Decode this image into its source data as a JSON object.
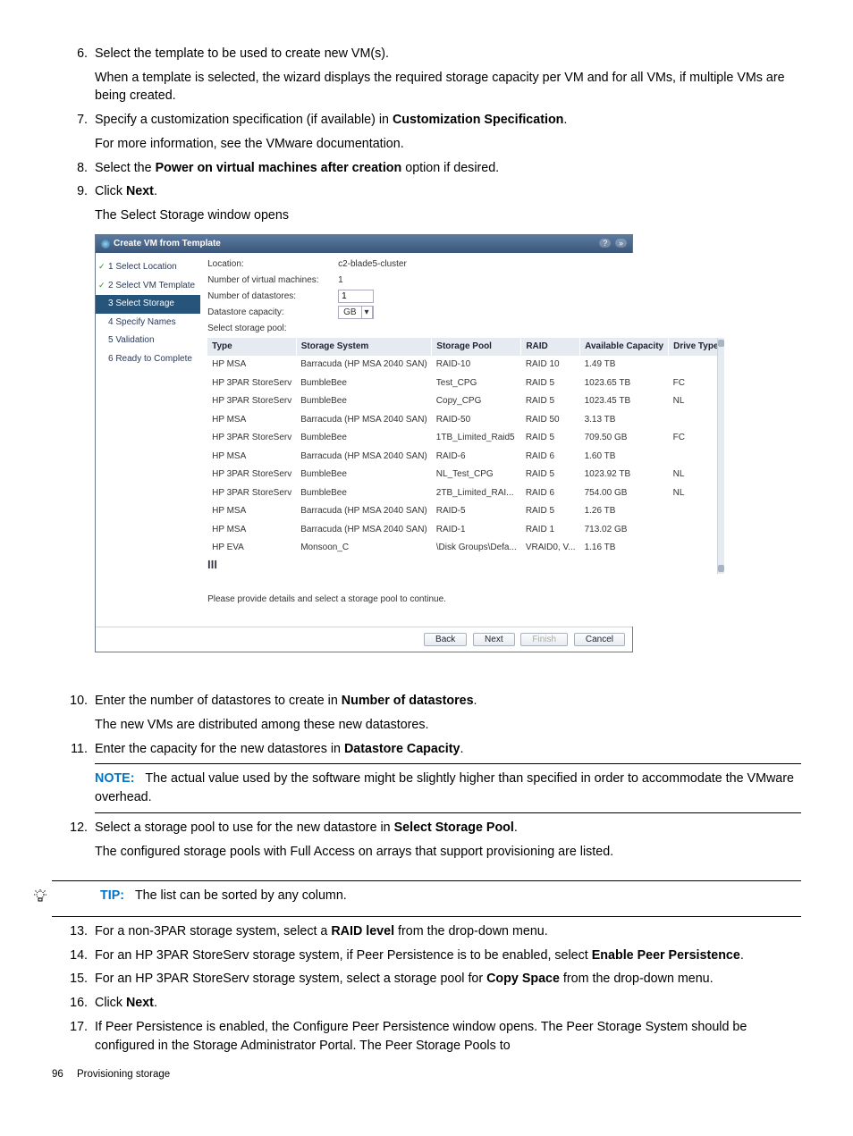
{
  "steps": {
    "s6": {
      "num": "6.",
      "p1": "Select the template to be used to create new VM(s).",
      "p2": "When a template is selected, the wizard displays the required storage capacity per VM and for all VMs, if multiple VMs are being created."
    },
    "s7": {
      "num": "7.",
      "p1a": "Specify a customization specification (if available) in ",
      "p1b": "Customization Specification",
      "p1c": ".",
      "p2": "For more information, see the VMware documentation."
    },
    "s8": {
      "num": "8.",
      "p1a": "Select the ",
      "p1b": "Power on virtual machines after creation",
      "p1c": " option if desired."
    },
    "s9": {
      "num": "9.",
      "p1a": "Click ",
      "p1b": "Next",
      "p1c": ".",
      "p2": "The Select Storage window opens"
    },
    "s10": {
      "num": "10.",
      "p1a": "Enter the number of datastores to create in ",
      "p1b": "Number of datastores",
      "p1c": ".",
      "p2": "The new VMs are distributed among these new datastores."
    },
    "s11": {
      "num": "11.",
      "p1a": "Enter the capacity for the new datastores in ",
      "p1b": "Datastore Capacity",
      "p1c": "."
    },
    "note": {
      "label": "NOTE:",
      "text": "The actual value used by the software might be slightly higher than specified in order to accommodate the VMware overhead."
    },
    "s12": {
      "num": "12.",
      "p1a": "Select a storage pool to use for the new datastore in ",
      "p1b": "Select Storage Pool",
      "p1c": ".",
      "p2": "The configured storage pools with Full Access on arrays that support provisioning are listed."
    },
    "tip": {
      "label": "TIP:",
      "text": "The list can be sorted by any column."
    },
    "s13": {
      "num": "13.",
      "p1a": "For a non-3PAR storage system, select a ",
      "p1b": "RAID level",
      "p1c": " from the drop-down menu."
    },
    "s14": {
      "num": "14.",
      "p1a": "For an HP 3PAR StoreServ storage system, if Peer Persistence is to be enabled, select ",
      "p1b": "Enable Peer Persistence",
      "p1c": "."
    },
    "s15": {
      "num": "15.",
      "p1a": "For an HP 3PAR StoreServ storage system, select a storage pool for ",
      "p1b": "Copy Space",
      "p1c": " from the drop-down menu."
    },
    "s16": {
      "num": "16.",
      "p1a": "Click ",
      "p1b": "Next",
      "p1c": "."
    },
    "s17": {
      "num": "17.",
      "p1": "If Peer Persistence is enabled, the Configure Peer Persistence window opens. The Peer Storage System should be configured in the Storage Administrator Portal. The Peer Storage Pools to"
    }
  },
  "dialog": {
    "title": "Create VM from Template",
    "nav": {
      "step1": "1 Select Location",
      "step2": "2 Select VM Template",
      "step3": "3 Select Storage",
      "step4": "4 Specify Names",
      "step5": "5 Validation",
      "step6": "6 Ready to Complete"
    },
    "form": {
      "location_lbl": "Location:",
      "location_val": "c2-blade5-cluster",
      "numvm_lbl": "Number of virtual machines:",
      "numvm_val": "1",
      "numds_lbl": "Number of datastores:",
      "numds_val": "1",
      "cap_lbl": "Datastore capacity:",
      "cap_unit": "GB",
      "selpool_lbl": "Select storage pool:"
    },
    "table": {
      "headers": {
        "type": "Type",
        "system": "Storage System",
        "pool": "Storage Pool",
        "raid": "RAID",
        "cap": "Available Capacity",
        "drive": "Drive Type"
      },
      "rows": [
        {
          "type": "HP MSA",
          "system": "Barracuda (HP MSA 2040 SAN)",
          "pool": "RAID-10",
          "raid": "RAID 10",
          "cap": "1.49 TB",
          "drive": ""
        },
        {
          "type": "HP 3PAR StoreServ",
          "system": "BumbleBee",
          "pool": "Test_CPG",
          "raid": "RAID 5",
          "cap": "1023.65 TB",
          "drive": "FC"
        },
        {
          "type": "HP 3PAR StoreServ",
          "system": "BumbleBee",
          "pool": "Copy_CPG",
          "raid": "RAID 5",
          "cap": "1023.45 TB",
          "drive": "NL"
        },
        {
          "type": "HP MSA",
          "system": "Barracuda (HP MSA 2040 SAN)",
          "pool": "RAID-50",
          "raid": "RAID 50",
          "cap": "3.13 TB",
          "drive": ""
        },
        {
          "type": "HP 3PAR StoreServ",
          "system": "BumbleBee",
          "pool": "1TB_Limited_Raid5",
          "raid": "RAID 5",
          "cap": "709.50 GB",
          "drive": "FC"
        },
        {
          "type": "HP MSA",
          "system": "Barracuda (HP MSA 2040 SAN)",
          "pool": "RAID-6",
          "raid": "RAID 6",
          "cap": "1.60 TB",
          "drive": ""
        },
        {
          "type": "HP 3PAR StoreServ",
          "system": "BumbleBee",
          "pool": "NL_Test_CPG",
          "raid": "RAID 5",
          "cap": "1023.92 TB",
          "drive": "NL"
        },
        {
          "type": "HP 3PAR StoreServ",
          "system": "BumbleBee",
          "pool": "2TB_Limited_RAI...",
          "raid": "RAID 6",
          "cap": "754.00 GB",
          "drive": "NL"
        },
        {
          "type": "HP MSA",
          "system": "Barracuda (HP MSA 2040 SAN)",
          "pool": "RAID-5",
          "raid": "RAID 5",
          "cap": "1.26 TB",
          "drive": ""
        },
        {
          "type": "HP MSA",
          "system": "Barracuda (HP MSA 2040 SAN)",
          "pool": "RAID-1",
          "raid": "RAID 1",
          "cap": "713.02 GB",
          "drive": ""
        },
        {
          "type": "HP EVA",
          "system": "Monsoon_C",
          "pool": "\\Disk Groups\\Defa...",
          "raid": "VRAID0, V...",
          "cap": "1.16 TB",
          "drive": ""
        }
      ]
    },
    "hint": "Please provide details and select a storage pool to continue.",
    "buttons": {
      "back": "Back",
      "next": "Next",
      "finish": "Finish",
      "cancel": "Cancel"
    }
  },
  "footer": {
    "page": "96",
    "section": "Provisioning storage"
  }
}
